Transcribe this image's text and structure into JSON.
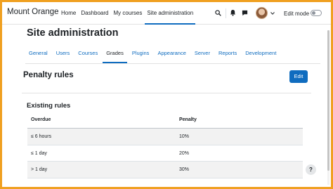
{
  "site": {
    "name": "Mount Orange"
  },
  "primary_nav": {
    "items": [
      {
        "label": "Home"
      },
      {
        "label": "Dashboard"
      },
      {
        "label": "My courses"
      },
      {
        "label": "Site administration"
      }
    ],
    "active_index": 3
  },
  "user_menu": {
    "edit_mode_label": "Edit mode",
    "edit_mode_on": false
  },
  "header": {
    "title": "Site administration"
  },
  "tabs": {
    "items": [
      {
        "label": "General"
      },
      {
        "label": "Users"
      },
      {
        "label": "Courses"
      },
      {
        "label": "Grades"
      },
      {
        "label": "Plugins"
      },
      {
        "label": "Appearance"
      },
      {
        "label": "Server"
      },
      {
        "label": "Reports"
      },
      {
        "label": "Development"
      }
    ],
    "active_index": 3
  },
  "penalty": {
    "title": "Penalty rules",
    "edit_label": "Edit",
    "existing_heading": "Existing rules",
    "columns": [
      "Overdue",
      "Penalty"
    ],
    "rows": [
      {
        "overdue": "≤ 6 hours",
        "penalty": "10%"
      },
      {
        "overdue": "≤ 1 day",
        "penalty": "20%"
      },
      {
        "overdue": "> 1 day",
        "penalty": "30%"
      }
    ]
  },
  "help": {
    "label": "?"
  },
  "colors": {
    "accent": "#0f6cbf",
    "frame": "#f0a020"
  }
}
